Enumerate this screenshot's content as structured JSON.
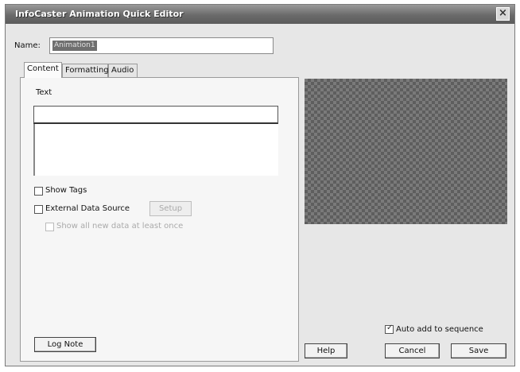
{
  "window": {
    "title": "InfoCaster Animation Quick Editor",
    "close_glyph": "×"
  },
  "name": {
    "label": "Name:",
    "value": "Animation1"
  },
  "tabs": [
    {
      "label": "Content",
      "active": true
    },
    {
      "label": "Formatting",
      "active": false
    },
    {
      "label": "Audio",
      "active": false
    }
  ],
  "content": {
    "text_label": "Text",
    "text_value": "",
    "show_tags": {
      "label": "Show Tags",
      "checked": false
    },
    "external_data_source": {
      "label": "External Data Source",
      "checked": false
    },
    "setup_button": "Setup",
    "show_all_new_data": {
      "label": "Show all new data at least once",
      "checked": false,
      "enabled": false
    }
  },
  "buttons": {
    "log_note": "Log Note",
    "help": "Help",
    "cancel": "Cancel",
    "save": "Save"
  },
  "auto_add": {
    "label": "Auto add to sequence",
    "checked": true,
    "check_glyph": "✓"
  }
}
